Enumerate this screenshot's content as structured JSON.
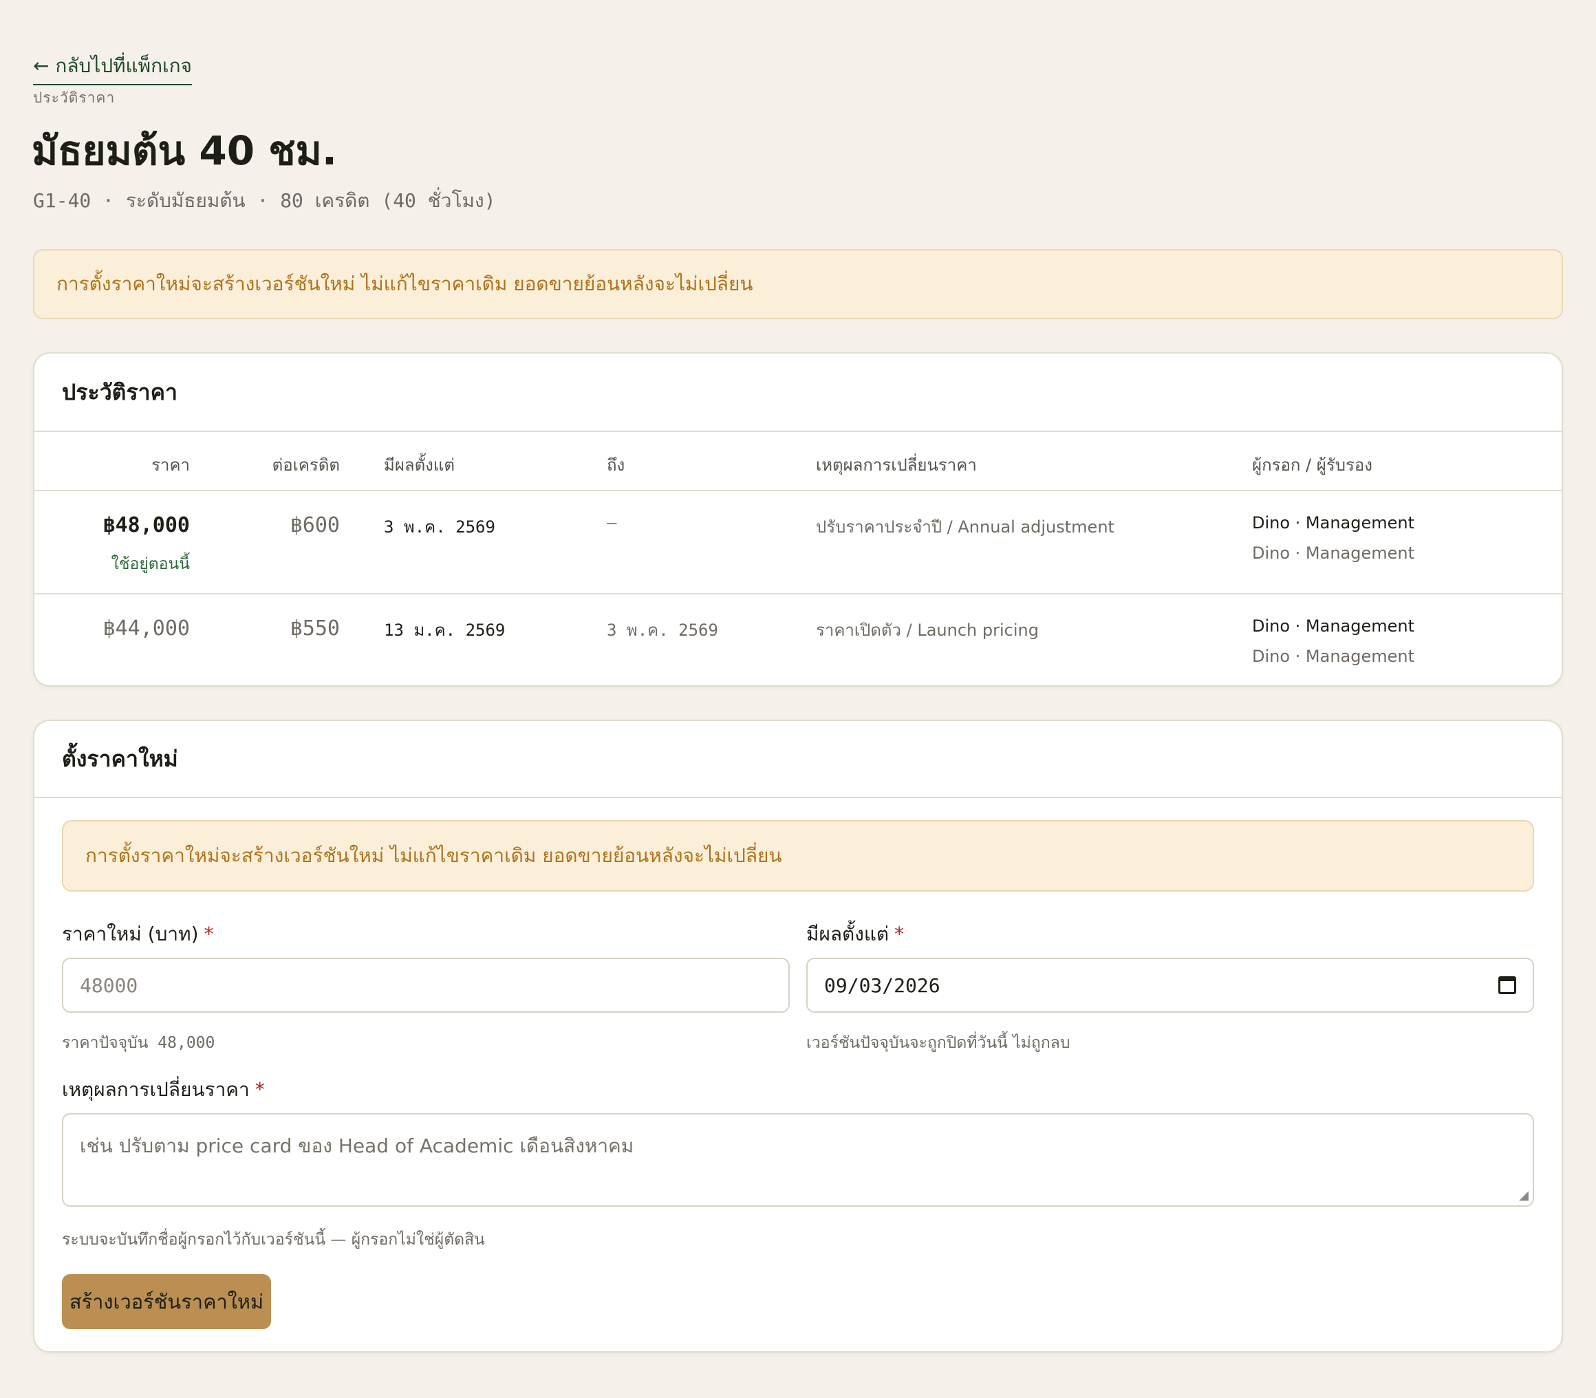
{
  "header": {
    "back_link": "← กลับไปที่แพ็กเกจ",
    "eyebrow": "ประวัติราคา",
    "title": "มัธยมต้น 40 ชม.",
    "subtitle": "G1-40 · ระดับมัธยมต้น · 80 เครดิต (40 ชั่วโมง)"
  },
  "notice_text": "การตั้งราคาใหม่จะสร้างเวอร์ชันใหม่ ไม่แก้ไขราคาเดิม ยอดขายย้อนหลังจะไม่เปลี่ยน",
  "history": {
    "title": "ประวัติราคา",
    "columns": [
      "ราคา",
      "ต่อเครดิต",
      "มีผลตั้งแต่",
      "ถึง",
      "เหตุผลการเปลี่ยนราคา",
      "ผู้กรอก / ผู้รับรอง"
    ],
    "rows": [
      {
        "price": "฿48,000",
        "status": "ใช้อยู่ตอนนี้",
        "per_credit": "฿600",
        "from": "3 พ.ค. 2569",
        "to": "—",
        "reason": "ปรับราคาประจำปี / Annual adjustment",
        "entered_by": "Dino · Management",
        "approved_by": "Dino · Management"
      },
      {
        "price": "฿44,000",
        "status": "",
        "per_credit": "฿550",
        "from": "13 ม.ค. 2569",
        "to": "3 พ.ค. 2569",
        "reason": "ราคาเปิดตัว / Launch pricing",
        "entered_by": "Dino · Management",
        "approved_by": "Dino · Management"
      }
    ]
  },
  "form": {
    "title": "ตั้งราคาใหม่",
    "price_label": "ราคาใหม่ (บาท)",
    "required_mark": "*",
    "price_placeholder": "48000",
    "price_hint": "ราคาปัจจุบัน 48,000",
    "date_label": "มีผลตั้งแต่",
    "date_value": "09/03/2026",
    "date_hint": "เวอร์ชันปัจจุบันจะถูกปิดที่วันนี้ ไม่ถูกลบ",
    "reason_label": "เหตุผลการเปลี่ยนราคา",
    "reason_placeholder": "เช่น ปรับตาม price card ของ Head of Academic เดือนสิงหาคม",
    "reason_hint": "ระบบจะบันทึกชื่อผู้กรอกไว้กับเวอร์ชันนี้ — ผู้กรอกไม่ใช่ผู้ตัดสิน",
    "submit_label": "สร้างเวอร์ชันราคาใหม่"
  },
  "colors": {
    "background": "#f5f1ea",
    "accent_green": "#1e4a2a",
    "notice_bg": "#fbefd9",
    "notice_text": "#b0721a",
    "button_bg": "#bb8f52",
    "required": "#b3261e"
  },
  "icons": {
    "back": "arrow-left-icon",
    "calendar": "calendar-icon",
    "resize": "resize-handle-icon"
  }
}
